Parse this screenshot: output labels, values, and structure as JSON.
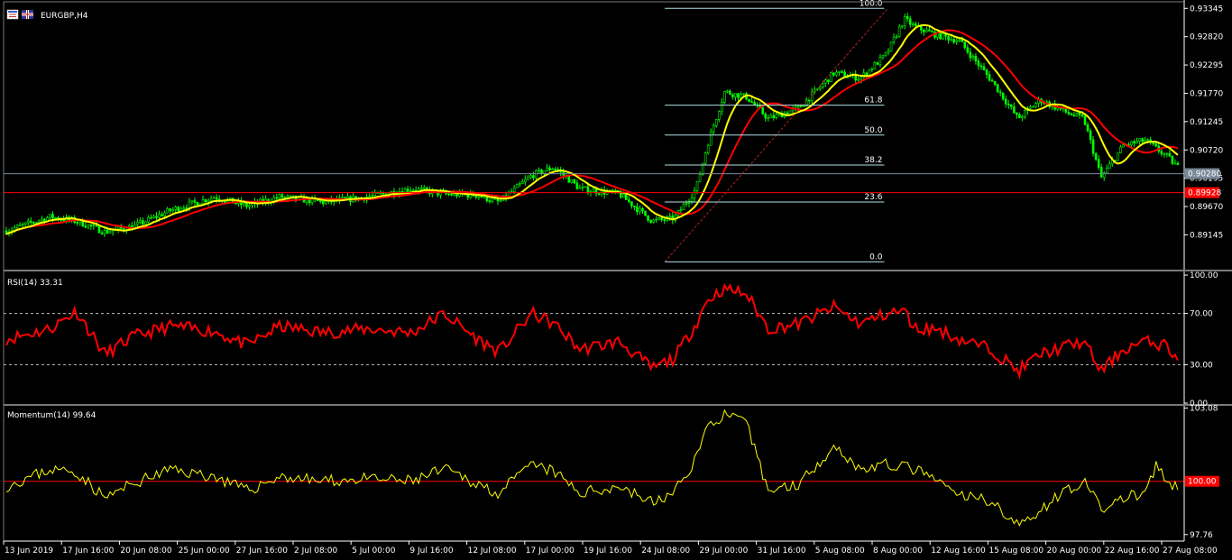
{
  "window": {
    "symbol_title": "EURGBP,H4"
  },
  "colors": {
    "background": "#000000",
    "axis": "#ffffff",
    "separator": "#7a7a7a",
    "bull_candle": "#00ff00",
    "bear_candle": "#00ff00",
    "ma_fast": "#ffff00",
    "ma_slow": "#ff0000",
    "fibo": "#b0e0e6",
    "fibo_trend": "#b22222",
    "rsi_line": "#ff0000",
    "momentum_line": "#ffff00",
    "momentum_level": "#ff0000",
    "current_price_line": "#778899",
    "red_level_line": "#ff0000"
  },
  "chart_data": [
    {
      "name": "price",
      "type": "candlestick",
      "y_ticks": [
        "0.93345",
        "0.92820",
        "0.92295",
        "0.91770",
        "0.91245",
        "0.90720",
        "0.90195",
        "0.89670",
        "0.89145"
      ],
      "ylim": [
        0.885,
        0.934
      ],
      "current_price": 0.9028,
      "current_price_label": "0.90280",
      "red_level": 0.89928,
      "red_level_label": "0.89928",
      "fibonacci": {
        "high": 0.93345,
        "low": 0.88645,
        "levels": [
          {
            "label": "100.0",
            "ratio": 1.0
          },
          {
            "label": "61.8",
            "ratio": 0.618
          },
          {
            "label": "50.0",
            "ratio": 0.5
          },
          {
            "label": "38.2",
            "ratio": 0.382
          },
          {
            "label": "23.6",
            "ratio": 0.236
          },
          {
            "label": "0.0",
            "ratio": 0.0
          }
        ],
        "start_bar": 300,
        "end_bar": 400
      },
      "ma_fast_period": 10,
      "ma_slow_period": 21,
      "bars": 430,
      "seed": 7,
      "path": [
        [
          0,
          0.8922
        ],
        [
          20,
          0.8948
        ],
        [
          32,
          0.894
        ],
        [
          45,
          0.892
        ],
        [
          58,
          0.893
        ],
        [
          75,
          0.896
        ],
        [
          95,
          0.8985
        ],
        [
          110,
          0.8968
        ],
        [
          125,
          0.8985
        ],
        [
          145,
          0.8975
        ],
        [
          165,
          0.8985
        ],
        [
          185,
          0.9
        ],
        [
          200,
          0.899
        ],
        [
          215,
          0.8988
        ],
        [
          225,
          0.8975
        ],
        [
          240,
          0.9025
        ],
        [
          250,
          0.904
        ],
        [
          262,
          0.9
        ],
        [
          280,
          0.899
        ],
        [
          295,
          0.894
        ],
        [
          305,
          0.8945
        ],
        [
          315,
          0.9
        ],
        [
          320,
          0.908
        ],
        [
          328,
          0.918
        ],
        [
          338,
          0.917
        ],
        [
          348,
          0.913
        ],
        [
          362,
          0.915
        ],
        [
          378,
          0.9215
        ],
        [
          390,
          0.9205
        ],
        [
          402,
          0.925
        ],
        [
          410,
          0.9315
        ],
        [
          415,
          0.93
        ],
        [
          425,
          0.9285
        ],
        [
          435,
          0.9275
        ],
        [
          450,
          0.92
        ],
        [
          462,
          0.913
        ],
        [
          472,
          0.9165
        ],
        [
          485,
          0.914
        ],
        [
          492,
          0.913
        ],
        [
          500,
          0.902
        ],
        [
          510,
          0.908
        ],
        [
          520,
          0.909
        ],
        [
          530,
          0.906
        ],
        [
          535,
          0.904
        ]
      ]
    },
    {
      "name": "rsi",
      "type": "line",
      "title": "RSI(14) 33.31",
      "y_ticks": [
        "100.00",
        "70.00",
        "30.00",
        "0.00"
      ],
      "levels": [
        70,
        30
      ],
      "ylim": [
        0,
        100
      ],
      "path": [
        [
          0,
          50
        ],
        [
          20,
          58
        ],
        [
          32,
          72
        ],
        [
          45,
          38
        ],
        [
          58,
          52
        ],
        [
          75,
          60
        ],
        [
          95,
          56
        ],
        [
          110,
          45
        ],
        [
          125,
          60
        ],
        [
          145,
          55
        ],
        [
          165,
          58
        ],
        [
          185,
          55
        ],
        [
          200,
          70
        ],
        [
          215,
          50
        ],
        [
          225,
          40
        ],
        [
          240,
          70
        ],
        [
          250,
          62
        ],
        [
          262,
          42
        ],
        [
          280,
          48
        ],
        [
          295,
          27
        ],
        [
          305,
          35
        ],
        [
          315,
          62
        ],
        [
          320,
          80
        ],
        [
          328,
          90
        ],
        [
          338,
          85
        ],
        [
          348,
          58
        ],
        [
          362,
          62
        ],
        [
          378,
          75
        ],
        [
          390,
          62
        ],
        [
          402,
          70
        ],
        [
          410,
          72
        ],
        [
          415,
          58
        ],
        [
          425,
          58
        ],
        [
          435,
          50
        ],
        [
          450,
          42
        ],
        [
          462,
          25
        ],
        [
          472,
          38
        ],
        [
          485,
          45
        ],
        [
          492,
          48
        ],
        [
          500,
          25
        ],
        [
          510,
          42
        ],
        [
          520,
          48
        ],
        [
          530,
          45
        ],
        [
          535,
          33.31
        ]
      ]
    },
    {
      "name": "momentum",
      "type": "line",
      "title": "Momentum(14) 99.64",
      "y_ticks": [
        "103.08",
        "100.00",
        "97.76"
      ],
      "level": 100.0,
      "level_label": "100.00",
      "ylim": [
        97.6,
        103.1
      ],
      "path": [
        [
          0,
          99.8
        ],
        [
          20,
          100.5
        ],
        [
          32,
          100.4
        ],
        [
          45,
          99.3
        ],
        [
          58,
          99.9
        ],
        [
          75,
          100.5
        ],
        [
          95,
          100.2
        ],
        [
          110,
          99.6
        ],
        [
          125,
          100.2
        ],
        [
          145,
          100.0
        ],
        [
          165,
          100.1
        ],
        [
          185,
          100.0
        ],
        [
          200,
          100.5
        ],
        [
          215,
          99.9
        ],
        [
          225,
          99.5
        ],
        [
          240,
          100.7
        ],
        [
          250,
          100.4
        ],
        [
          262,
          99.5
        ],
        [
          280,
          99.8
        ],
        [
          295,
          99.1
        ],
        [
          305,
          99.5
        ],
        [
          315,
          101.0
        ],
        [
          320,
          102.3
        ],
        [
          328,
          102.8
        ],
        [
          338,
          102.4
        ],
        [
          348,
          99.6
        ],
        [
          362,
          99.9
        ],
        [
          378,
          101.5
        ],
        [
          390,
          100.5
        ],
        [
          402,
          100.7
        ],
        [
          410,
          100.6
        ],
        [
          415,
          100.5
        ],
        [
          425,
          100.0
        ],
        [
          435,
          99.4
        ],
        [
          450,
          99.2
        ],
        [
          462,
          98.1
        ],
        [
          472,
          98.8
        ],
        [
          485,
          99.7
        ],
        [
          492,
          100.0
        ],
        [
          500,
          98.8
        ],
        [
          510,
          99.3
        ],
        [
          520,
          99.5
        ],
        [
          525,
          100.6
        ],
        [
          530,
          100.0
        ],
        [
          535,
          99.64
        ]
      ]
    }
  ],
  "x_axis": {
    "labels": [
      "13 Jun 2019",
      "17 Jun 16:00",
      "20 Jun 08:00",
      "25 Jun 00:00",
      "27 Jun 16:00",
      "2 Jul 08:00",
      "5 Jul 00:00",
      "9 Jul 16:00",
      "12 Jul 08:00",
      "17 Jul 00:00",
      "19 Jul 16:00",
      "24 Jul 08:00",
      "29 Jul 00:00",
      "31 Jul 16:00",
      "5 Aug 08:00",
      "8 Aug 00:00",
      "12 Aug 16:00",
      "15 Aug 08:00",
      "20 Aug 00:00",
      "22 Aug 16:00",
      "27 Aug 08:00"
    ]
  }
}
